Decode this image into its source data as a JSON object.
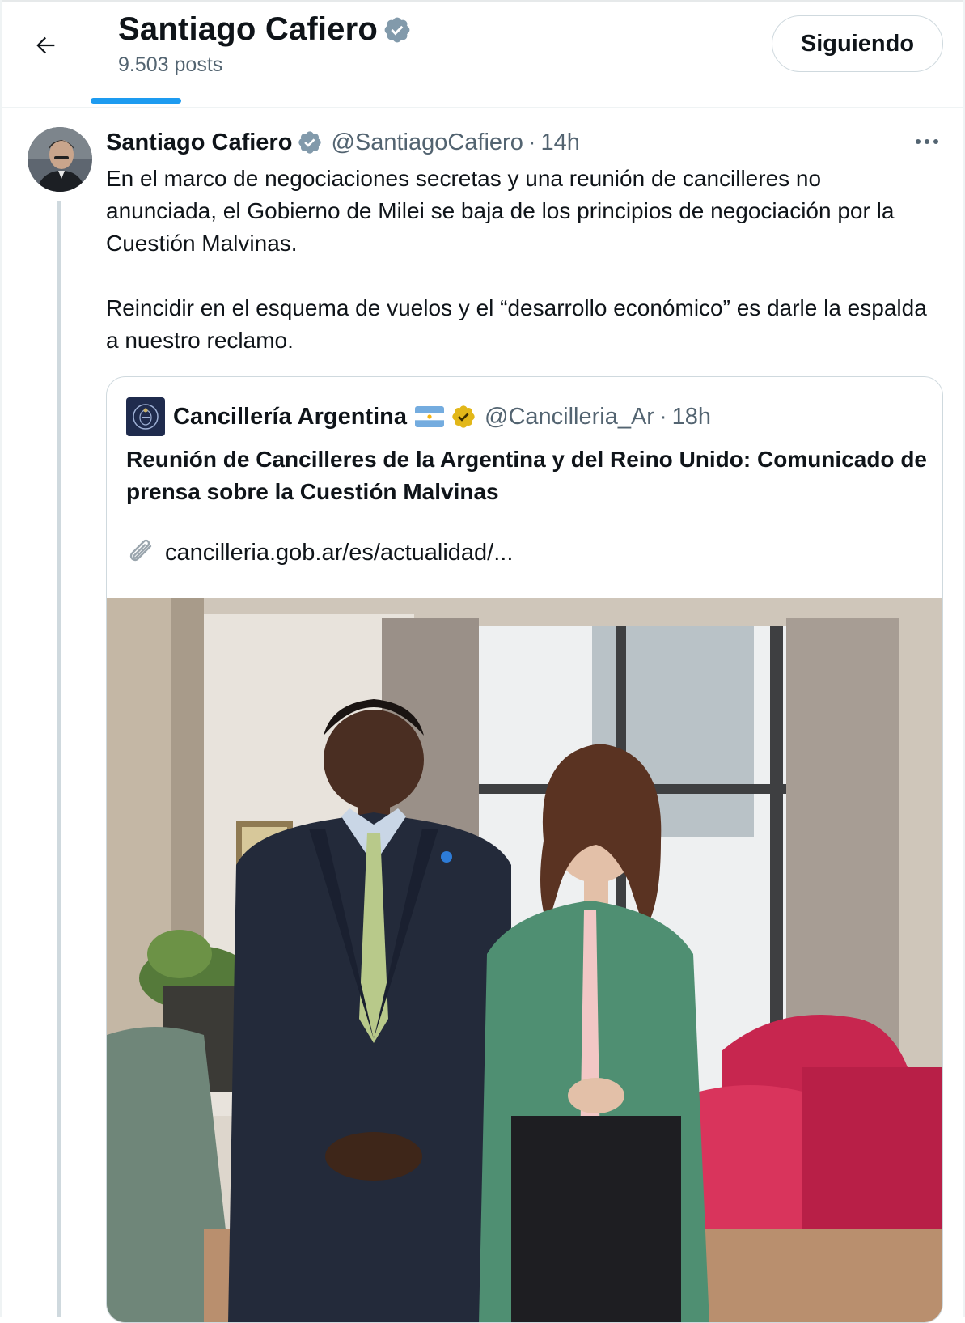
{
  "header": {
    "title": "Santiago Cafiero",
    "posts_count": "9.503 posts",
    "follow_button": "Siguiendo"
  },
  "tweet": {
    "author_name": "Santiago Cafiero",
    "handle": "@SantiagoCafiero",
    "separator": "·",
    "time": "14h",
    "paragraph_1": "En el marco de negociaciones secretas y una reunión de cancilleres no anunciada, el Gobierno de Milei se baja de los principios de negociación por la Cuestión Malvinas.",
    "paragraph_2": "Reincidir en el esquema de vuelos y el “desarrollo económico” es darle la espalda a nuestro reclamo."
  },
  "quote": {
    "author_name": "Cancillería Argentina",
    "handle": "@Cancilleria_Ar",
    "separator": "·",
    "time": "18h",
    "title": "Reunión de Cancilleres de la Argentina y del Reino Unido: Comunicado de prensa sobre la Cuestión Malvinas",
    "link": "cancilleria.gob.ar/es/actualidad/..."
  },
  "icons": {
    "back": "arrow-left-icon",
    "verified": "verified-badge-icon",
    "gold_verified": "gold-verified-badge-icon",
    "flag": "argentina-flag-icon",
    "more": "more-dots-icon",
    "link": "paperclip-icon"
  },
  "colors": {
    "accent": "#1d9bf0",
    "verified_blue": "#829aab",
    "gold_badge": "#e2b719",
    "secondary_text": "#536471",
    "border": "#cfd9de"
  }
}
